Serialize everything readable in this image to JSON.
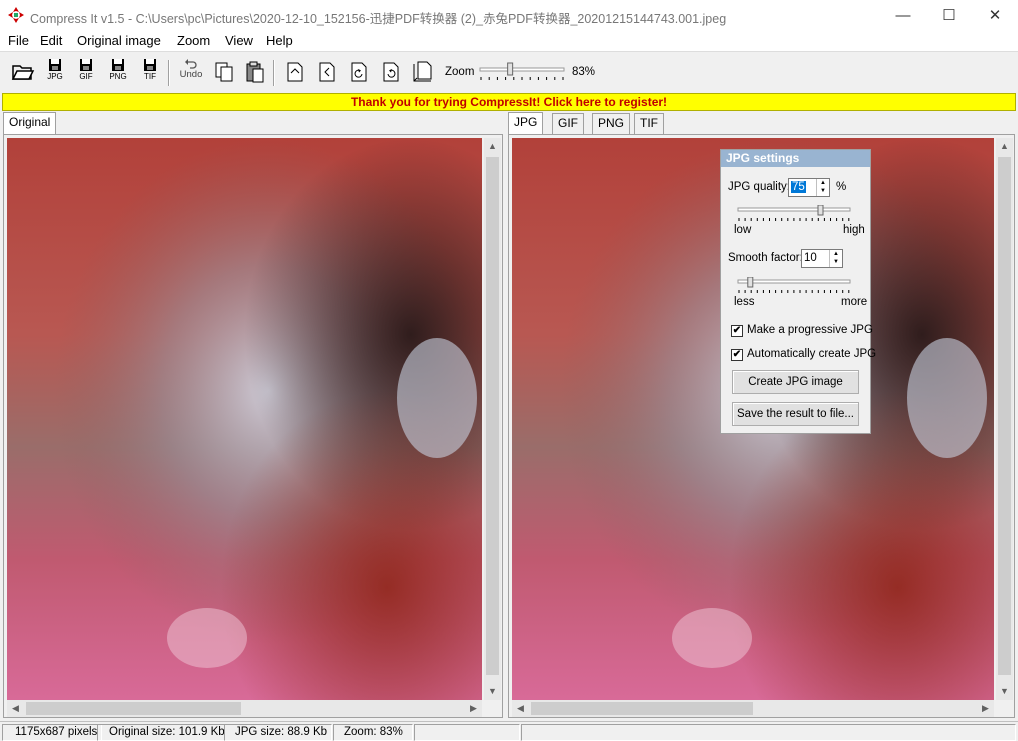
{
  "window": {
    "title": "Compress It v1.5 - C:\\Users\\pc\\Pictures\\2020-12-10_152156-迅捷PDF转换器 (2)_赤兔PDF转换器_20201215144743.001.jpeg",
    "minimize": "—",
    "maximize": "☐",
    "close": "✕"
  },
  "menu": [
    "File",
    "Edit",
    "Original image",
    "Zoom",
    "View",
    "Help"
  ],
  "toolbar": {
    "jpg": "JPG",
    "gif": "GIF",
    "png": "PNG",
    "tif": "TIF",
    "undo": "Undo",
    "zoom_label": "Zoom",
    "zoom_value": "83%",
    "zoom_fraction": 0.35
  },
  "banner": "Thank you for trying CompressIt! Click here to register!",
  "left_tabs": [
    "Original"
  ],
  "right_tabs": [
    "JPG",
    "GIF",
    "PNG",
    "TIF"
  ],
  "jpg_settings": {
    "title": "JPG settings",
    "quality_label": "JPG quality:",
    "quality_value": "75",
    "percent": "%",
    "quality_fraction": 0.75,
    "low": "low",
    "high": "high",
    "smooth_label": "Smooth factor:",
    "smooth_value": "10",
    "smooth_fraction": 0.1,
    "less": "less",
    "more": "more",
    "progressive_label": "Make a progressive JPG",
    "progressive_checked": true,
    "auto_label": "Automatically create JPG",
    "auto_checked": true,
    "create_button": "Create JPG image",
    "save_button": "Save the result to file..."
  },
  "status": {
    "dimensions": "1175x687 pixels",
    "original_size": "Original size: 101.9 Kb",
    "jpg_size": "JPG size: 88.9 Kb",
    "zoom": "Zoom: 83%"
  },
  "colors": {
    "banner_bg": "#ffff00",
    "banner_text": "#c00000",
    "settings_title_bg": "#99b4d1"
  }
}
